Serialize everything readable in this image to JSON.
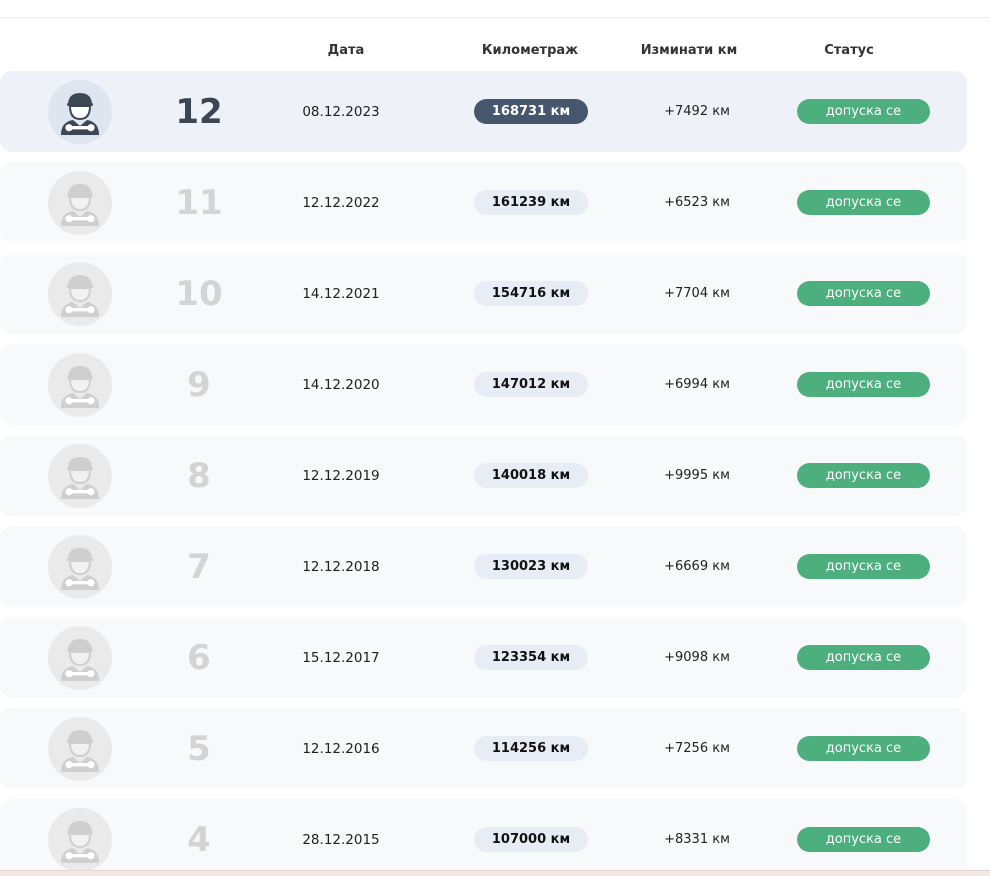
{
  "header": {
    "date": "Дата",
    "km": "Километраж",
    "diff": "Изминати км",
    "status": "Статус"
  },
  "colors": {
    "active_row": "#eef2f8",
    "row": "#f8f9fa",
    "active_km_pill": "#46566d",
    "km_pill": "#e7ecf5",
    "status_pill": "#4caf7d"
  },
  "avatar_icon": "mechanic-icon",
  "rows": [
    {
      "num": "12",
      "date": "08.12.2023",
      "km": "168731 км",
      "diff": "+7492 км",
      "status": "допуска се",
      "active": true
    },
    {
      "num": "11",
      "date": "12.12.2022",
      "km": "161239 км",
      "diff": "+6523 км",
      "status": "допуска се",
      "active": false
    },
    {
      "num": "10",
      "date": "14.12.2021",
      "km": "154716 км",
      "diff": "+7704 км",
      "status": "допуска се",
      "active": false
    },
    {
      "num": "9",
      "date": "14.12.2020",
      "km": "147012 км",
      "diff": "+6994 км",
      "status": "допуска се",
      "active": false
    },
    {
      "num": "8",
      "date": "12.12.2019",
      "km": "140018 км",
      "diff": "+9995 км",
      "status": "допуска се",
      "active": false
    },
    {
      "num": "7",
      "date": "12.12.2018",
      "km": "130023 км",
      "diff": "+6669 км",
      "status": "допуска се",
      "active": false
    },
    {
      "num": "6",
      "date": "15.12.2017",
      "km": "123354 км",
      "diff": "+9098 км",
      "status": "допуска се",
      "active": false
    },
    {
      "num": "5",
      "date": "12.12.2016",
      "km": "114256 км",
      "diff": "+7256 км",
      "status": "допуска се",
      "active": false
    },
    {
      "num": "4",
      "date": "28.12.2015",
      "km": "107000 км",
      "diff": "+8331 км",
      "status": "допуска се",
      "active": false
    }
  ]
}
